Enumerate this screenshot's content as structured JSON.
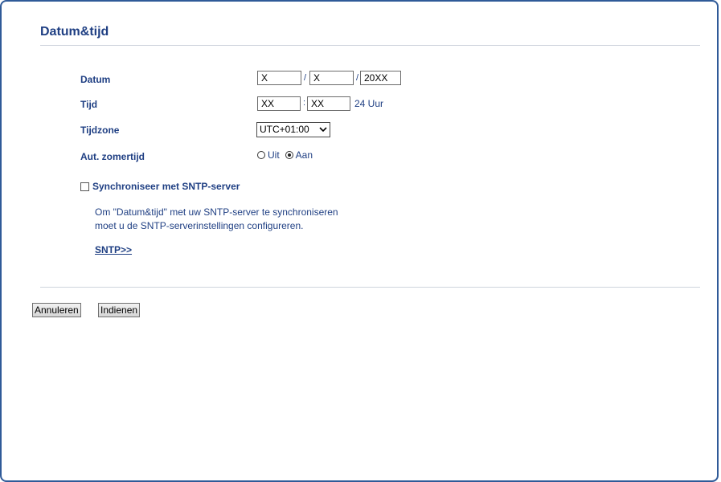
{
  "page": {
    "title": "Datum&tijd"
  },
  "form": {
    "date": {
      "label": "Datum",
      "day": "X",
      "month": "X",
      "year": "20XX",
      "separator": "/"
    },
    "time": {
      "label": "Tijd",
      "hours": "XX",
      "minutes": "XX",
      "separator": ":",
      "format_label": "24 Uur"
    },
    "timezone": {
      "label": "Tijdzone",
      "selected": "UTC+01:00"
    },
    "dst": {
      "label": "Aut. zomertijd",
      "options": [
        "Uit",
        "Aan"
      ],
      "selected": "Aan"
    },
    "sntp_sync": {
      "label": "Synchroniseer met SNTP-server",
      "checked": false,
      "info_line1": "Om \"Datum&tijd\" met uw SNTP-server te synchroniseren",
      "info_line2": "moet u de SNTP-serverinstellingen configureren.",
      "link": "SNTP>>"
    }
  },
  "buttons": {
    "cancel": "Annuleren",
    "submit": "Indienen"
  },
  "colors": {
    "text": "#1f3f83",
    "frame": "#2f5a98"
  }
}
